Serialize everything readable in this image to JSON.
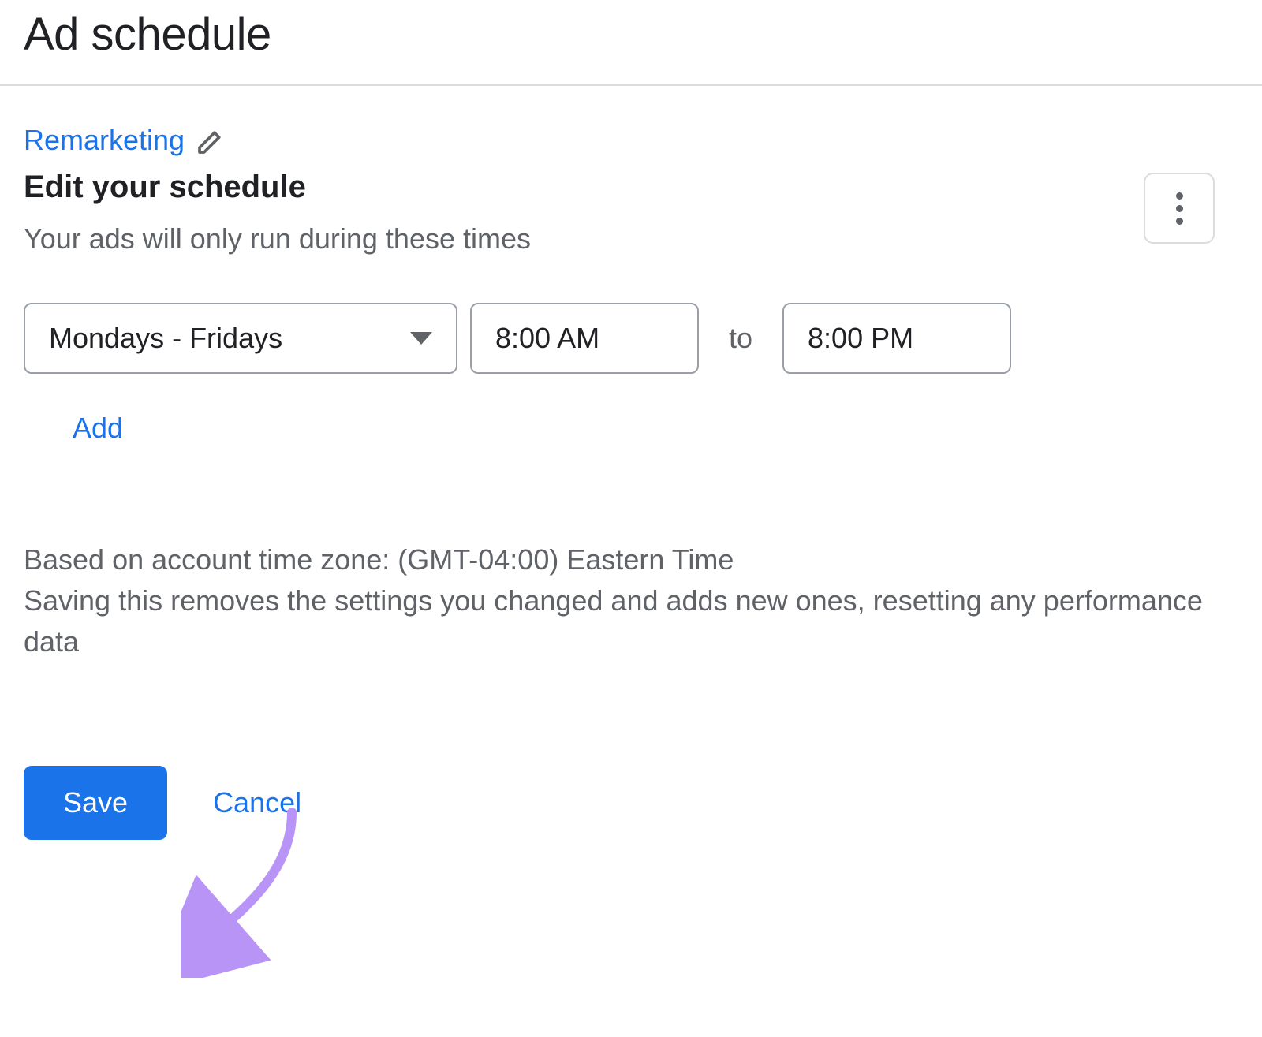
{
  "page_title": "Ad schedule",
  "breadcrumb": {
    "label": "Remarketing"
  },
  "section": {
    "title": "Edit your schedule",
    "subtitle": "Your ads will only run during these times"
  },
  "schedule": {
    "days": "Mondays - Fridays",
    "start": "8:00 AM",
    "separator": "to",
    "end": "8:00 PM"
  },
  "add_label": "Add",
  "notes": {
    "line1": "Based on account time zone: (GMT-04:00) Eastern Time",
    "line2": "Saving this removes the settings you changed and adds new ones, resetting any performance data"
  },
  "actions": {
    "save": "Save",
    "cancel": "Cancel"
  },
  "colors": {
    "accent": "#1a73e8",
    "annotation": "#b794f6"
  }
}
